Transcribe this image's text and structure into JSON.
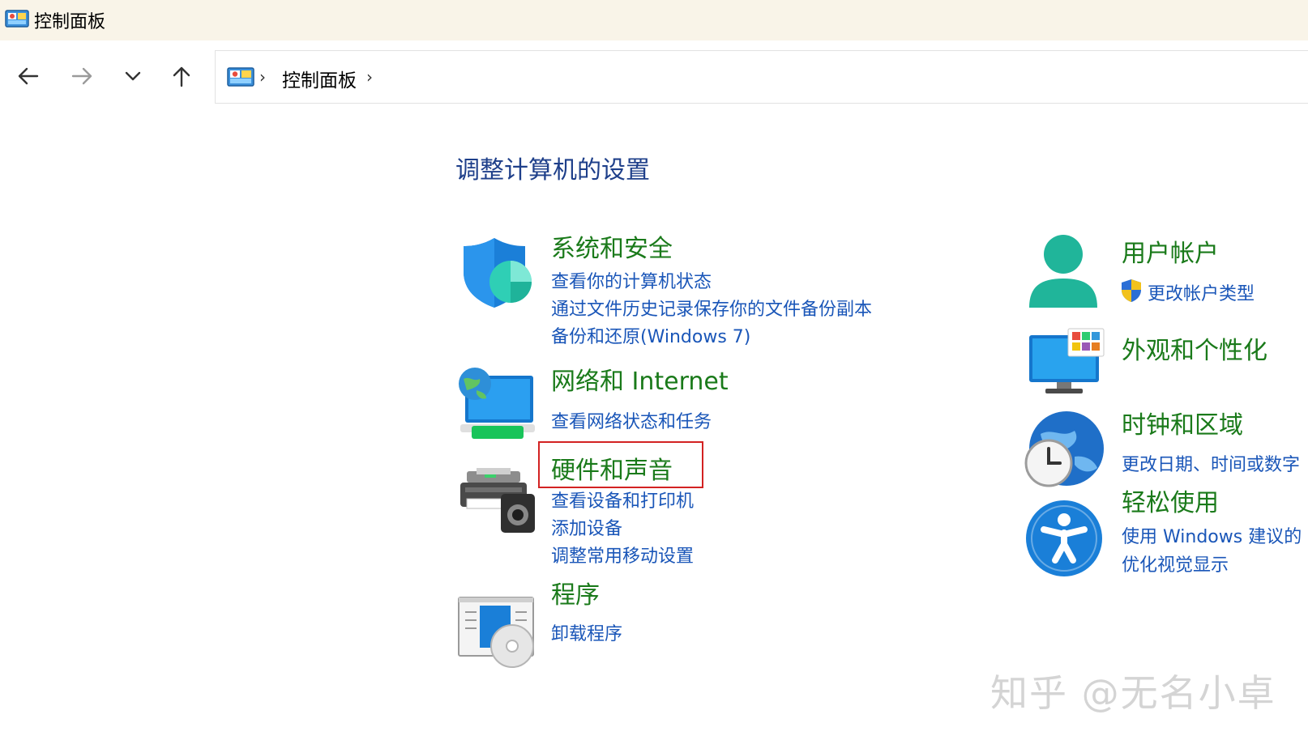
{
  "window": {
    "title": "控制面板"
  },
  "nav": {
    "back_icon": "arrow-left-icon",
    "forward_icon": "arrow-right-icon",
    "recent_icon": "chevron-down-icon",
    "up_icon": "arrow-up-icon"
  },
  "breadcrumb": {
    "items": [
      "控制面板"
    ]
  },
  "main": {
    "heading": "调整计算机的设置",
    "left_categories": [
      {
        "title": "系统和安全",
        "icon": "shield-icon",
        "links": [
          "查看你的计算机状态",
          "通过文件历史记录保存你的文件备份副本",
          "备份和还原(Windows 7)"
        ]
      },
      {
        "title": "网络和 Internet",
        "icon": "network-globe-icon",
        "links": [
          "查看网络状态和任务"
        ]
      },
      {
        "title": "硬件和声音",
        "icon": "printer-speaker-icon",
        "highlighted": true,
        "links": [
          "查看设备和打印机",
          "添加设备",
          "调整常用移动设置"
        ]
      },
      {
        "title": "程序",
        "icon": "programs-disc-icon",
        "links": [
          "卸载程序"
        ]
      }
    ],
    "right_categories": [
      {
        "title": "用户帐户",
        "icon": "user-icon",
        "links": [
          "更改帐户类型"
        ],
        "link_icon": "uac-shield-icon"
      },
      {
        "title": "外观和个性化",
        "icon": "monitor-personalize-icon",
        "links": []
      },
      {
        "title": "时钟和区域",
        "icon": "clock-globe-icon",
        "links": [
          "更改日期、时间或数字"
        ]
      },
      {
        "title": "轻松使用",
        "icon": "accessibility-icon",
        "links": [
          "使用 Windows 建议的",
          "优化视觉显示"
        ]
      }
    ]
  },
  "watermark": "知乎 @无名小卓",
  "colors": {
    "category_title": "#1a7a1a",
    "link": "#1a56b8",
    "heading": "#1e3f8a",
    "highlight": "#d32222",
    "titlebar_bg": "#f9f4e8"
  }
}
